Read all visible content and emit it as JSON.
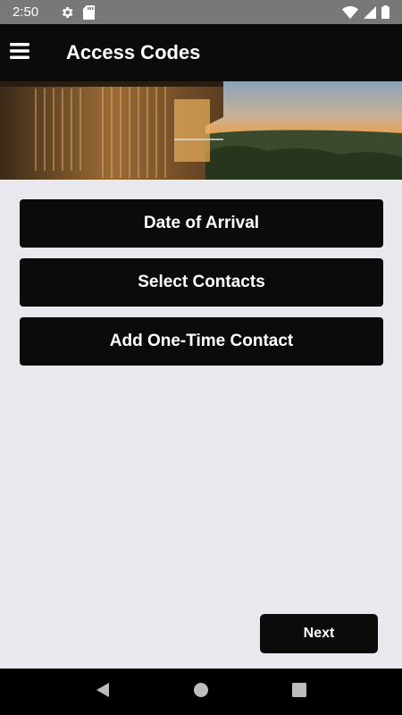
{
  "status_bar": {
    "time": "2:50",
    "icons": [
      "settings-icon",
      "sd-card-icon",
      "wifi-icon",
      "signal-icon",
      "battery-icon"
    ]
  },
  "app_bar": {
    "title": "Access Codes",
    "menu_icon": "hamburger-menu-icon"
  },
  "actions": {
    "date_of_arrival": "Date of Arrival",
    "select_contacts": "Select Contacts",
    "add_one_time_contact": "Add One-Time Contact"
  },
  "footer": {
    "next_label": "Next"
  },
  "nav_bar": {
    "icons": [
      "back-icon",
      "home-icon",
      "recents-icon"
    ]
  },
  "colors": {
    "background": "#e9e8ee",
    "app_bar": "#0b0b0b",
    "button": "#0b0b0b",
    "status_bar": "#787878"
  }
}
